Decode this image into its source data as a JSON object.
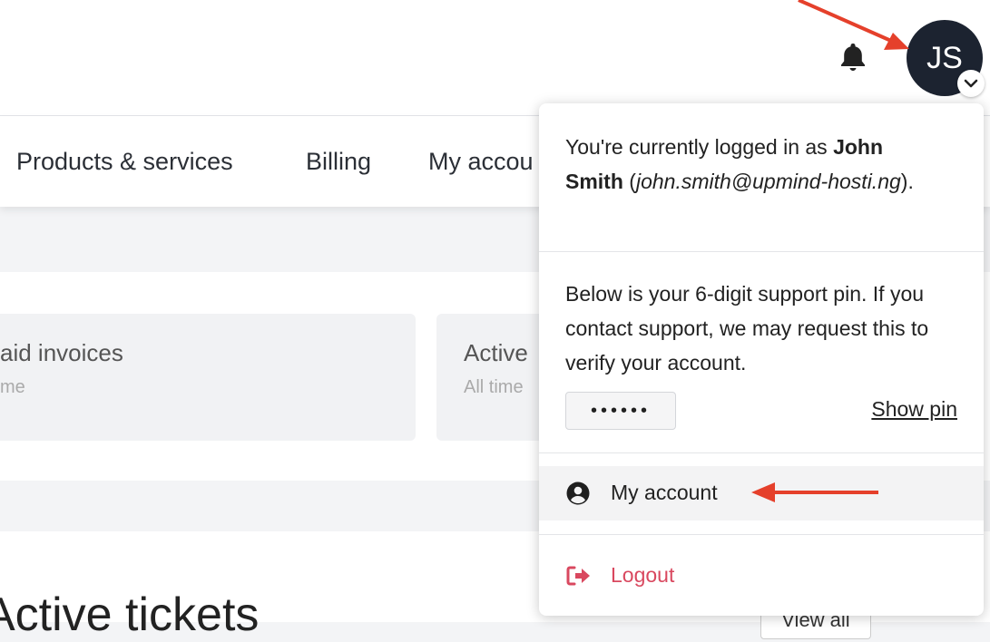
{
  "header": {
    "avatar_initials": "JS",
    "icons": [
      "bell-icon",
      "chevron-down-icon"
    ]
  },
  "nav": {
    "items": [
      "Products & services",
      "Billing",
      "My accou"
    ]
  },
  "stats": [
    {
      "title": "aid invoices",
      "subtitle": "me"
    },
    {
      "title": "Active",
      "subtitle": "All time"
    }
  ],
  "tickets": {
    "title": "Active tickets",
    "view_all": "View all"
  },
  "dropdown": {
    "logged_in_prefix": "You're currently logged in as ",
    "user_name": "John Smith",
    "open_paren": " (",
    "user_email": "john.smith@upmind-hosti.ng",
    "close_paren": ").",
    "pin_text": "Below is your 6-digit support pin. If you contact support, we may request this to verify your account.",
    "pin_masked": "••••••",
    "show_pin": "Show pin",
    "my_account": "My account",
    "logout": "Logout"
  },
  "colors": {
    "annotation_arrow": "#e5402b",
    "logout": "#d9485f",
    "avatar_bg": "#1c2330"
  }
}
